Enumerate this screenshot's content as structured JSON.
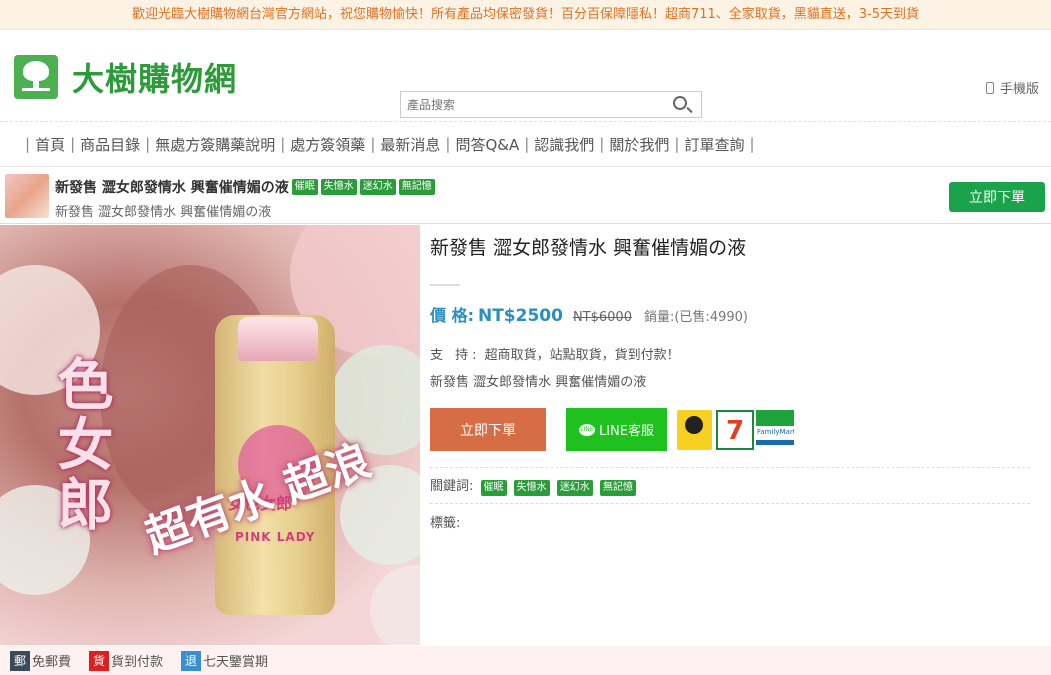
{
  "announcement": "歡迎光臨大樹購物網台灣官方網站，祝您購物愉快！所有產品均保密發貨！百分百保障隱私！超商711、全家取貨，黑貓直送，3-5天到貨",
  "logo": {
    "text": "大樹購物網"
  },
  "search": {
    "placeholder": "產品搜索"
  },
  "mobile_link": "手機版",
  "nav": [
    "首頁",
    "商品目錄",
    "無處方簽購藥說明",
    "處方簽領藥",
    "最新消息",
    "問答Q&A",
    "認識我們",
    "關於我們",
    "訂單查詢"
  ],
  "product_bar": {
    "title": "新發售 澀女郎發情水 興奮催情媚の液",
    "tags": [
      "催眠",
      "失憶水",
      "迷幻水",
      "無記憶"
    ],
    "subtitle": "新發售 澀女郎發情水 興奮催情媚の液",
    "order_label": "立即下單"
  },
  "image_overlay": {
    "slogan": "超有水 超浪",
    "vertical": "色女郎",
    "bottle_text": "女色女郎",
    "bottle_sub": "PINK LADY"
  },
  "product": {
    "title": "新發售 澀女郎發情水 興奮催情媚の液",
    "price_label": "價 格:",
    "price": "NT$2500",
    "old_price": "NT$6000",
    "sold": "銷量:(已售:4990)",
    "support_label": "支 持:",
    "support_text": "超商取貨，站點取貨，貨到付款！",
    "description": "新發售 澀女郎發情水 興奮催情媚の液",
    "order_label": "立即下單",
    "line_label": "LINE客服",
    "line_icon_text": "LINE",
    "seven_logo": "7",
    "fm_logo": "FamilyMart",
    "keywords_label": "關鍵詞:",
    "keywords": [
      "催眠",
      "失憶水",
      "迷幻水",
      "無記憶"
    ],
    "tags_label": "標籤:"
  },
  "footer": [
    {
      "badge": "郵",
      "text": "免郵費",
      "color": "#3a4a5a"
    },
    {
      "badge": "貨",
      "text": "貨到付款",
      "color": "#e02020"
    },
    {
      "badge": "退",
      "text": "七天鑒賞期",
      "color": "#3a8fd0"
    }
  ]
}
